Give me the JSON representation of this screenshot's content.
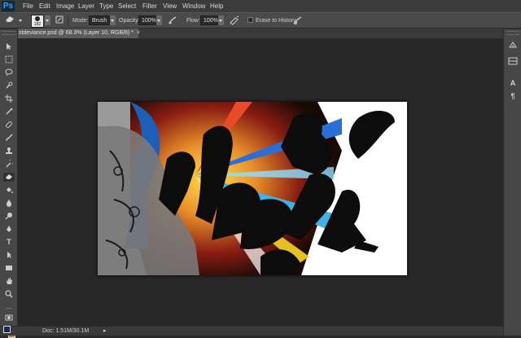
{
  "app": {
    "logo": "Ps"
  },
  "menu": [
    "File",
    "Edit",
    "Image",
    "Layer",
    "Type",
    "Select",
    "Filter",
    "View",
    "Window",
    "Help"
  ],
  "options": {
    "tool_icon": "eraser-icon",
    "brush_size": "182",
    "mode_label": "Mode:",
    "mode_value": "Brush",
    "opacity_label": "Opacity:",
    "opacity_value": "100%",
    "flow_label": "Flow:",
    "flow_value": "100%",
    "erase_history_label": "Erase to History"
  },
  "document": {
    "tab_title": "stdeviance.psd @ 68.3% (Layer 10, RGB/8) *",
    "close_symbol": "×"
  },
  "status": {
    "text": "Doc: 1.51M/30.1M",
    "arrow": "▸"
  },
  "colors": {
    "foreground": "#1a2a57",
    "background": "#c87a2e",
    "workspace": "#282828",
    "chrome": "#474747"
  },
  "tools": [
    "move-tool",
    "marquee-tool",
    "lasso-tool",
    "quick-select-tool",
    "crop-tool",
    "eyedropper-tool",
    "healing-brush-tool",
    "brush-tool",
    "clone-stamp-tool",
    "history-brush-tool",
    "eraser-tool",
    "paint-bucket-tool",
    "blur-tool",
    "dodge-tool",
    "pen-tool",
    "type-tool",
    "path-select-tool",
    "rectangle-tool",
    "hand-tool",
    "zoom-tool"
  ],
  "panels": [
    "history-panel-icon",
    "adjustments-panel-icon",
    "character-panel-icon",
    "paragraph-panel-icon"
  ]
}
